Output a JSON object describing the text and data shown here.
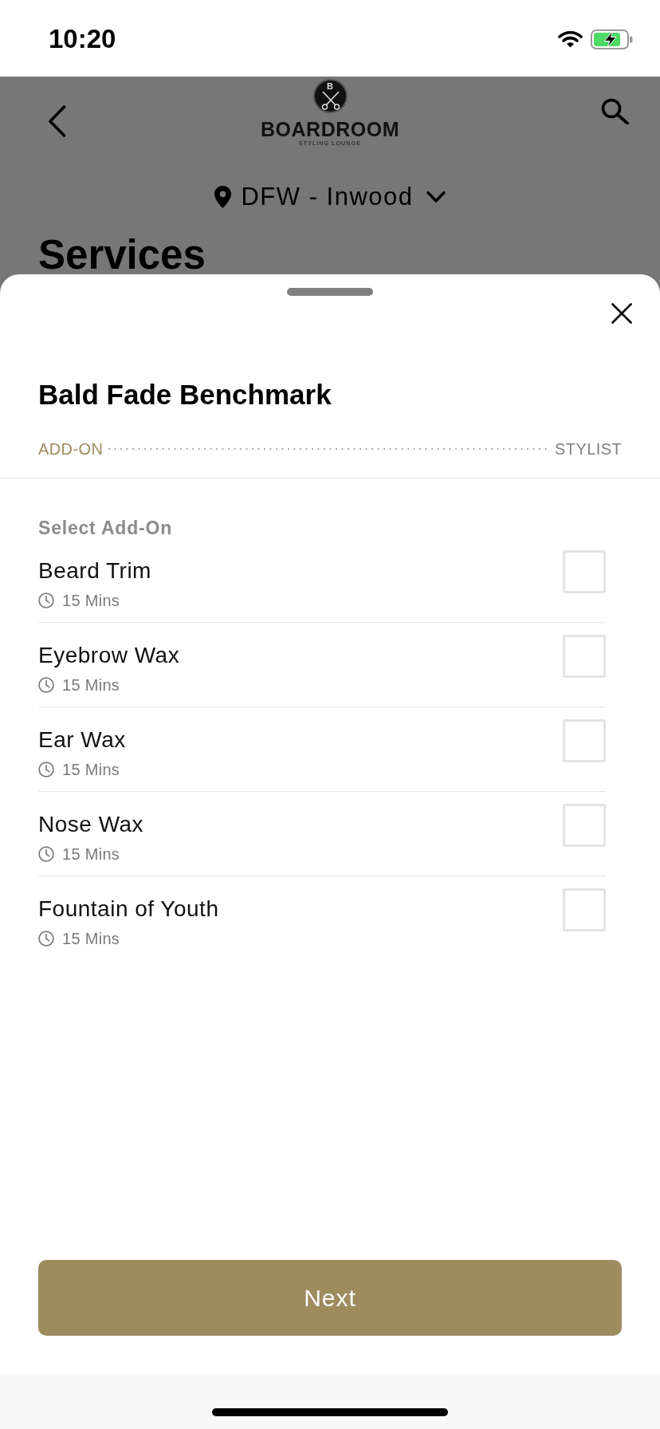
{
  "status_bar": {
    "time": "10:20"
  },
  "header": {
    "logo": {
      "monogram": "B",
      "name": "BOARDROOM",
      "tagline": "STYLING LOUNGE"
    },
    "location": "DFW - Inwood",
    "title": "Services"
  },
  "sheet": {
    "title": "Bald Fade Benchmark",
    "steps": [
      {
        "label": "ADD-ON",
        "selected": true
      },
      {
        "label": "STYLIST",
        "selected": false
      }
    ],
    "section_label": "Select Add-On",
    "items": [
      {
        "name": "Beard Trim",
        "duration": "15 Mins",
        "checked": false
      },
      {
        "name": "Eyebrow Wax",
        "duration": "15 Mins",
        "checked": false
      },
      {
        "name": "Ear Wax",
        "duration": "15 Mins",
        "checked": false
      },
      {
        "name": "Nose Wax",
        "duration": "15 Mins",
        "checked": false
      },
      {
        "name": "Fountain of Youth",
        "duration": "15 Mins",
        "checked": false
      }
    ],
    "next_button": "Next"
  }
}
